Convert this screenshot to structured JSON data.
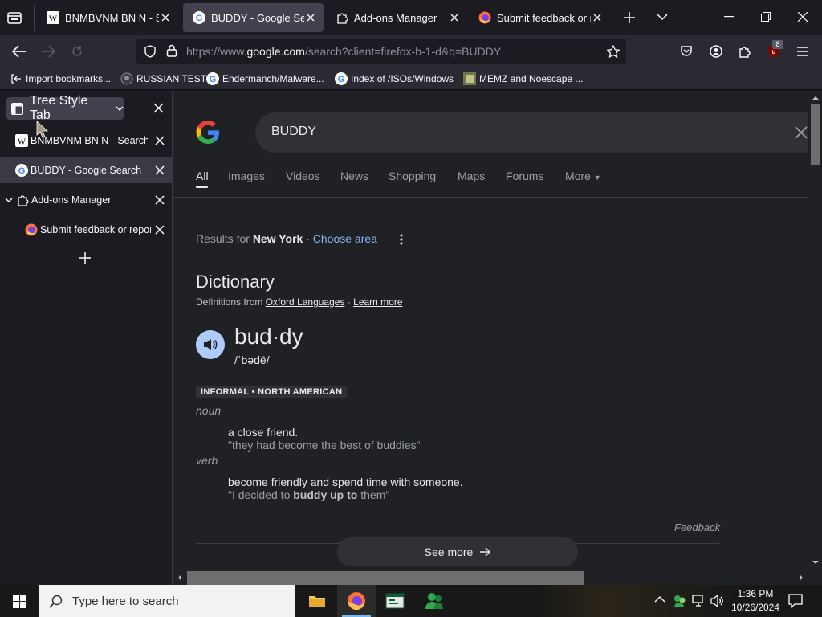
{
  "tabs": [
    {
      "title": "BNMBVNM BN N - Sea",
      "favicon": "wikipedia-icon"
    },
    {
      "title": "BUDDY - Google Search",
      "favicon": "google-icon"
    },
    {
      "title": "Add-ons Manager",
      "favicon": "puzzle-icon"
    },
    {
      "title": "Submit feedback or rep",
      "favicon": "firefox-icon"
    }
  ],
  "url": {
    "prefix": "https://www.",
    "domain": "google.com",
    "rest": "/search?client=firefox-b-1-d&q=BUDDY"
  },
  "extensions_badge": "8",
  "bookmarks": [
    {
      "label": "Import bookmarks...",
      "icon": "import-icon"
    },
    {
      "label": "RUSSIAN TEST",
      "icon": "github-icon"
    },
    {
      "label": "Endermanch/Malware...",
      "icon": "google-icon"
    },
    {
      "label": "Index of /ISOs/Windows",
      "icon": "google-icon"
    },
    {
      "label": "MEMZ and Noescape ...",
      "icon": "image-icon"
    }
  ],
  "sidebar": {
    "title": "Tree Style Tab",
    "tabs": [
      {
        "title": "BNMBVNM BN N - Search re"
      },
      {
        "title": "BUDDY - Google Search"
      },
      {
        "title": "Add-ons Manager"
      },
      {
        "title": "Submit feedback or report"
      }
    ]
  },
  "search": {
    "query": "BUDDY",
    "tabs": [
      "All",
      "Images",
      "Videos",
      "News",
      "Shopping",
      "Maps",
      "Forums",
      "More"
    ]
  },
  "location": {
    "prefix": "Results for",
    "place": "New York",
    "sep": "·",
    "choose": "Choose area"
  },
  "dictionary": {
    "heading": "Dictionary",
    "defs_from": "Definitions from",
    "source": "Oxford Languages",
    "sep": "·",
    "learn_more": "Learn more",
    "word": "bud·dy",
    "phonetic": "/ˈbədē/",
    "label": "INFORMAL • NORTH AMERICAN",
    "senses": [
      {
        "pos": "noun",
        "definition": "a close friend.",
        "example": "\"they had become the best of buddies\""
      },
      {
        "pos": "verb",
        "definition": "become friendly and spend time with someone.",
        "example_pre": "\"I decided to ",
        "example_bold": "buddy up to",
        "example_post": " them\""
      }
    ],
    "feedback": "Feedback",
    "see_more": "See more"
  },
  "taskbar": {
    "search_placeholder": "Type here to search",
    "time": "1:36 PM",
    "date": "10/26/2024"
  }
}
